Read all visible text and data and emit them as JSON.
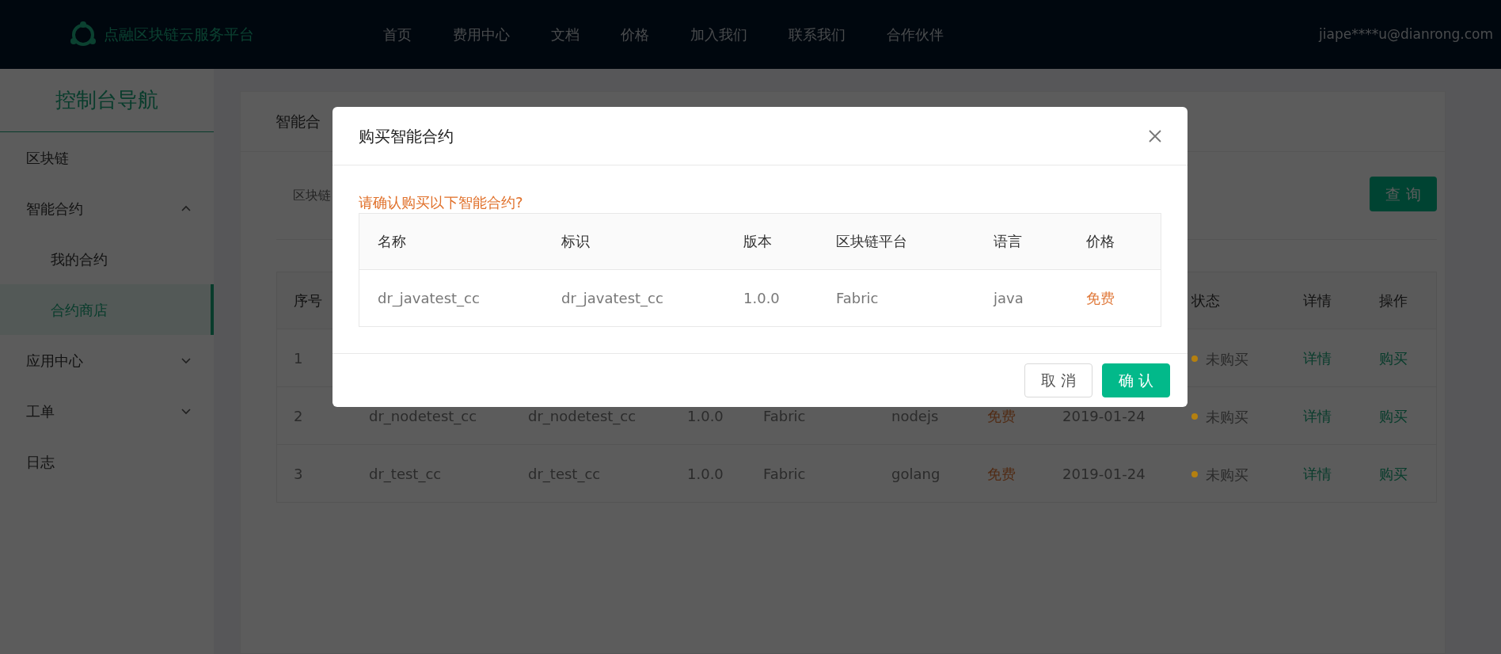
{
  "navbar": {
    "brand": "点融区块链云服务平台",
    "links": [
      "首页",
      "费用中心",
      "文档",
      "价格",
      "加入我们",
      "联系我们",
      "合作伙伴"
    ],
    "user": "jiape****u@dianrong.com"
  },
  "sidebar": {
    "title": "控制台导航",
    "items": [
      {
        "label": "区块链",
        "selected": false
      },
      {
        "label": "智能合约",
        "selected": false,
        "expanded": true,
        "children": [
          {
            "label": "我的合约",
            "selected": false
          },
          {
            "label": "合约商店",
            "selected": true
          }
        ]
      },
      {
        "label": "应用中心",
        "selected": false,
        "expanded": false
      },
      {
        "label": "工单",
        "selected": false,
        "expanded": false
      },
      {
        "label": "日志",
        "selected": false
      }
    ]
  },
  "card": {
    "title": "智能合",
    "filter_label": "区块链",
    "query_button": "查 询",
    "table": {
      "columns": [
        {
          "header": "序号",
          "kind": "text"
        },
        {
          "kind": "text"
        },
        {
          "kind": "text"
        },
        {
          "kind": "text"
        },
        {
          "kind": "text"
        },
        {
          "kind": "text"
        },
        {
          "kind": "price"
        },
        {
          "kind": "text"
        },
        {
          "header": "状态",
          "kind": "status"
        },
        {
          "header": "详情",
          "kind": "link"
        },
        {
          "header": "操作",
          "kind": "link"
        }
      ],
      "rows": [
        [
          "1",
          null,
          null,
          null,
          null,
          null,
          null,
          null,
          {
            "text": "未购买",
            "color": "#b5800f"
          },
          "详情",
          "购买"
        ],
        [
          "2",
          "dr_nodetest_cc",
          "dr_nodetest_cc",
          "1.0.0",
          "Fabric",
          "nodejs",
          "免费",
          "2019-01-24",
          {
            "text": "未购买",
            "color": "#b5800f"
          },
          "详情",
          "购买"
        ],
        [
          "3",
          "dr_test_cc",
          "dr_test_cc",
          "1.0.0",
          "Fabric",
          "golang",
          "免费",
          "2019-01-24",
          {
            "text": "未购买",
            "color": "#b5800f"
          },
          "详情",
          "购买"
        ]
      ]
    }
  },
  "modal": {
    "title": "购买智能合约",
    "prompt": "请确认购买以下智能合约?",
    "table": {
      "columns": [
        {
          "header": "名称",
          "kind": "text"
        },
        {
          "header": "标识",
          "kind": "text"
        },
        {
          "header": "版本",
          "kind": "text"
        },
        {
          "header": "区块链平台",
          "kind": "text"
        },
        {
          "header": "语言",
          "kind": "text"
        },
        {
          "header": "价格",
          "kind": "price"
        }
      ],
      "rows": [
        [
          "dr_javatest_cc",
          "dr_javatest_cc",
          "1.0.0",
          "Fabric",
          "java",
          "免费"
        ]
      ]
    },
    "buttons": [
      {
        "label": "取 消",
        "kind": "secondary"
      },
      {
        "label": "确 认",
        "kind": "primary"
      }
    ]
  }
}
